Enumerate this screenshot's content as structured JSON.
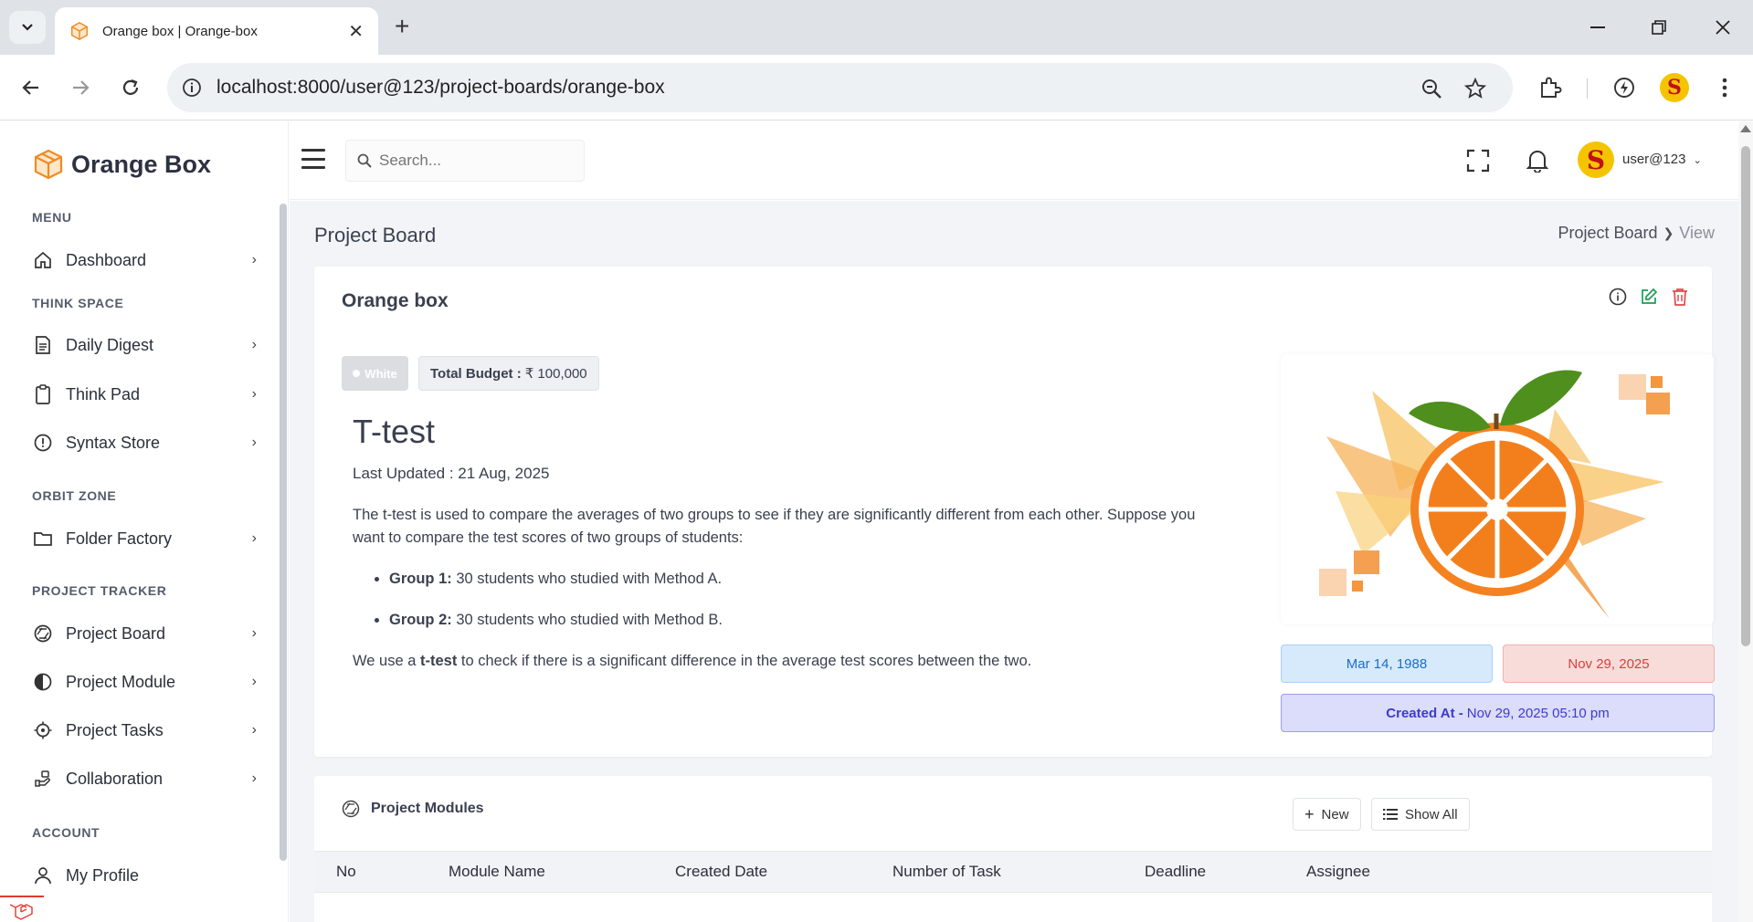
{
  "browser": {
    "tab_title": "Orange box | Orange-box",
    "url": "localhost:8000/user@123/project-boards/orange-box"
  },
  "brand": {
    "name": "Orange Box"
  },
  "sidebar": {
    "sections": {
      "menu": "MENU",
      "think_space": "THINK SPACE",
      "orbit_zone": "ORBIT ZONE",
      "project_tracker": "PROJECT TRACKER",
      "account": "ACCOUNT"
    },
    "items": {
      "dashboard": "Dashboard",
      "daily_digest": "Daily Digest",
      "think_pad": "Think Pad",
      "syntax_store": "Syntax Store",
      "folder_factory": "Folder Factory",
      "project_board": "Project Board",
      "project_module": "Project Module",
      "project_tasks": "Project Tasks",
      "collaboration": "Collaboration",
      "my_profile": "My Profile"
    }
  },
  "header": {
    "search_placeholder": "Search...",
    "user_name": "user@123"
  },
  "page": {
    "title": "Project Board",
    "breadcrumb": [
      "Project Board",
      "View"
    ]
  },
  "board": {
    "name": "Orange box",
    "status_badge": "White",
    "budget_label": "Total Budget :",
    "budget_value": "₹ 100,000",
    "item_title": "T-test",
    "last_updated": "Last Updated : 21 Aug, 2025",
    "description_p1": "The t-test is used to compare the averages of two groups to see if they are significantly different from each other. Suppose you want to compare the test scores of two groups of students:",
    "group1_label": "Group 1:",
    "group1_text": " 30 students who studied with Method A.",
    "group2_label": "Group 2:",
    "group2_text": " 30 students who studied with Method B.",
    "description_p2_pre": "We use a ",
    "description_p2_bold": "t-test",
    "description_p2_post": " to check if there is a significant difference in the average test scores between the two.",
    "start_date": "Mar 14, 1988",
    "end_date": "Nov 29, 2025",
    "created_label": "Created At -",
    "created_value": "Nov 29, 2025 05:10 pm"
  },
  "modules": {
    "title": "Project Modules",
    "new_label": "New",
    "show_all_label": "Show All",
    "columns": [
      "No",
      "Module Name",
      "Created Date",
      "Number of Task",
      "Deadline",
      "Assignee"
    ]
  },
  "colors": {
    "brand_orange": "#f08a24",
    "start_date_bg": "#d7eafc",
    "end_date_bg": "#f8dcda",
    "created_bg": "#dcdcfb"
  }
}
